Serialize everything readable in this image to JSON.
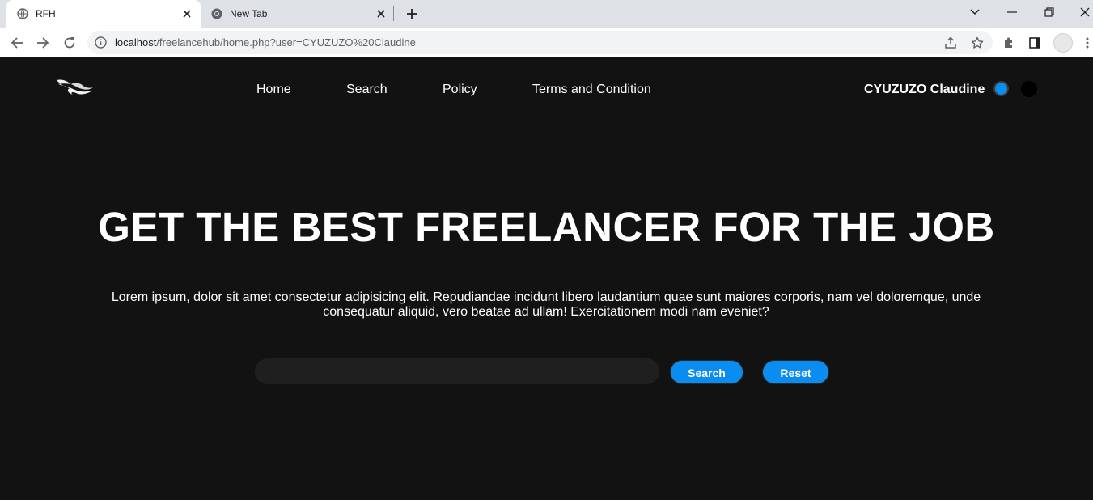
{
  "browser": {
    "tabs": [
      {
        "title": "RFH",
        "active": true
      },
      {
        "title": "New Tab",
        "active": false
      }
    ],
    "url": {
      "host": "localhost",
      "path": "/freelancehub/home.php?user=CYUZUZO%20Claudine"
    }
  },
  "nav": {
    "links": [
      "Home",
      "Search",
      "Policy",
      "Terms and Condition"
    ],
    "user_name": "CYUZUZO Claudine"
  },
  "hero": {
    "title": "GET THE BEST FREELANCER FOR THE JOB",
    "text": "Lorem ipsum, dolor sit amet consectetur adipisicing elit. Repudiandae incidunt libero laudantium quae sunt maiores corporis, nam vel doloremque, unde consequatur aliquid, vero beatae ad ullam! Exercitationem modi nam eveniet?"
  },
  "search": {
    "value": "",
    "placeholder": "",
    "search_label": "Search",
    "reset_label": "Reset"
  },
  "colors": {
    "background": "#121212",
    "accent": "#0a8cf0",
    "input_bg": "#1f1f1f"
  }
}
